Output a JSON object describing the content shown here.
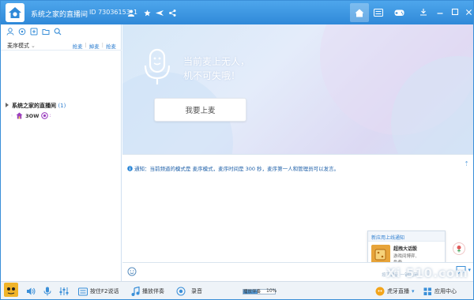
{
  "title_bar": {
    "title": "系统之家的直播间",
    "room_id": "ID 73036153",
    "user_count": "1"
  },
  "left_panel": {
    "mode_label": "麦序模式",
    "queue_buttons": [
      "抢麦",
      "掉麦",
      "抢麦"
    ],
    "room_name": "系统之家的直播间",
    "room_count": "(1)",
    "user_name": "3OW"
  },
  "mic_area": {
    "line1": "当前麦上无人，",
    "line2": "机不可失哦！",
    "button": "我要上麦"
  },
  "chat": {
    "notice": "通知：当前频道的模式是 麦序模式，麦序时间是 300 秒，麦序第一人和管理员可以发言。"
  },
  "popup": {
    "header": "新应用上线通知",
    "app_title": "超拽大话骰",
    "app_desc_line1": "游戏间博弈,",
    "app_desc_line2": "免费"
  },
  "input_bar": {
    "faint_text": "按下说话 一键关闭"
  },
  "bottom_bar": {
    "push_to_talk": "按住F2说话",
    "play_music": "播放伴奏",
    "record": "录音",
    "volume_label": "播放伴奏",
    "volume_pct": "10%",
    "huya_live": "虎牙直播",
    "app_center": "应用中心"
  },
  "watermark": {
    "text": "Xi 510.com"
  },
  "colors": {
    "titlebar": "#3a90dc",
    "accent": "#2f7fd0",
    "notice_text": "#1d5fa8"
  }
}
